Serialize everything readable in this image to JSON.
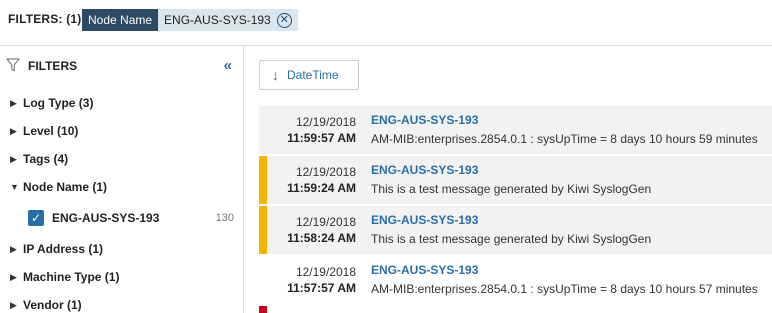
{
  "topbar": {
    "label": "FILTERS: (1)",
    "chip": {
      "key": "Node Name",
      "value": "ENG-AUS-SYS-193"
    }
  },
  "sidebar": {
    "title": "FILTERS",
    "groups": [
      {
        "label": "Log Type (3)",
        "expanded": false
      },
      {
        "label": "Level (10)",
        "expanded": false
      },
      {
        "label": "Tags (4)",
        "expanded": false
      },
      {
        "label": "Node Name (1)",
        "expanded": true
      },
      {
        "label": "IP Address (1)",
        "expanded": false
      },
      {
        "label": "Machine Type (1)",
        "expanded": false
      },
      {
        "label": "Vendor (1)",
        "expanded": false
      }
    ],
    "node_item": {
      "label": "ENG-AUS-SYS-193",
      "count": "130",
      "checked": true
    }
  },
  "main": {
    "sort_label": "DateTime",
    "logs": [
      {
        "date": "12/19/2018",
        "time": "11:59:57 AM",
        "host": "ENG-AUS-SYS-193",
        "message": "AM-MIB:enterprises.2854.0.1 : sysUpTime = 8 days 10 hours 59 minutes",
        "severity_color": ""
      },
      {
        "date": "12/19/2018",
        "time": "11:59:24 AM",
        "host": "ENG-AUS-SYS-193",
        "message": "This is a test message generated by Kiwi SyslogGen",
        "severity_color": "#f4b400"
      },
      {
        "date": "12/19/2018",
        "time": "11:58:24 AM",
        "host": "ENG-AUS-SYS-193",
        "message": "This is a test message generated by Kiwi SyslogGen",
        "severity_color": "#f4b400"
      },
      {
        "date": "12/19/2018",
        "time": "11:57:57 AM",
        "host": "ENG-AUS-SYS-193",
        "message": "AM-MIB:enterprises.2854.0.1 : sysUpTime = 8 days 10 hours 57 minutes",
        "severity_color": ""
      },
      {
        "date": "",
        "time": "",
        "host": "",
        "message": "",
        "severity_color": "#d0021b"
      }
    ]
  },
  "colors": {
    "accent": "#2a6ea6",
    "chip_dark": "#2a4a66",
    "warning": "#f4b400",
    "error": "#d0021b"
  },
  "icons": {
    "filter": "funnel-icon",
    "collapse": "double-chevron-left-icon",
    "sort": "arrow-down-icon",
    "remove": "close-circle-icon"
  }
}
